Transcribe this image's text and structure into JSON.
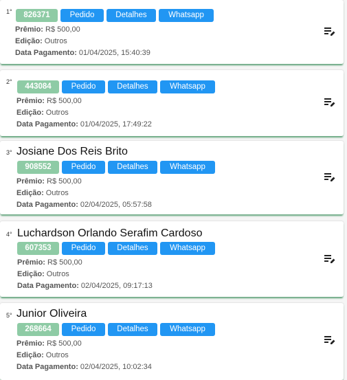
{
  "labels": {
    "premio": "Prêmio:",
    "edicao": "Edição:",
    "data_pagamento": "Data Pagamento:",
    "pedido": "Pedido",
    "detalhes": "Detalhes",
    "whatsapp": "Whatsapp"
  },
  "winners": [
    {
      "rank": "1°",
      "name": "",
      "code": "826371",
      "premio": "R$ 500,00",
      "edicao": "Outros",
      "data": "01/04/2025, 15:40:39"
    },
    {
      "rank": "2°",
      "name": "",
      "code": "443084",
      "premio": "R$ 500,00",
      "edicao": "Outros",
      "data": "01/04/2025, 17:49:22"
    },
    {
      "rank": "3°",
      "name": "Josiane Dos Reis Brito",
      "code": "908552",
      "premio": "R$ 500,00",
      "edicao": "Outros",
      "data": "02/04/2025, 05:57:58"
    },
    {
      "rank": "4°",
      "name": "Luchardson Orlando Serafim Cardoso",
      "code": "607353",
      "premio": "R$ 500,00",
      "edicao": "Outros",
      "data": "02/04/2025, 09:17:13"
    },
    {
      "rank": "5°",
      "name": "Junior Oliveira",
      "code": "268664",
      "premio": "R$ 500,00",
      "edicao": "Outros",
      "data": "02/04/2025, 10:02:34"
    }
  ],
  "icons": {
    "edit": "playlist-edit-icon"
  },
  "colors": {
    "code_badge": "#8ecba5",
    "button": "#2196f3",
    "card_shadow": "#5fa37a"
  }
}
